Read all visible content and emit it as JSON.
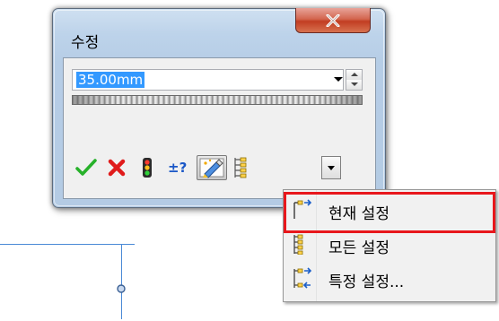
{
  "dialog": {
    "title": "수정",
    "value": "35.00mm",
    "close_glyph": "x"
  },
  "toolbar": {
    "icons": [
      "check-icon",
      "cancel-x-icon",
      "traffic-light-icon",
      "plus-minus-question-icon",
      "marker-pen-icon",
      "configuration-tree-icon"
    ]
  },
  "menu": {
    "items": [
      {
        "label": "현재 설정",
        "icon": "current-config-icon"
      },
      {
        "label": "모든 설정",
        "icon": "all-configs-icon"
      },
      {
        "label": "특정 설정...",
        "icon": "specific-configs-icon"
      }
    ]
  },
  "colors": {
    "highlight": "#e8171c",
    "selection": "#3399ff",
    "leader": "#4a89d6"
  }
}
